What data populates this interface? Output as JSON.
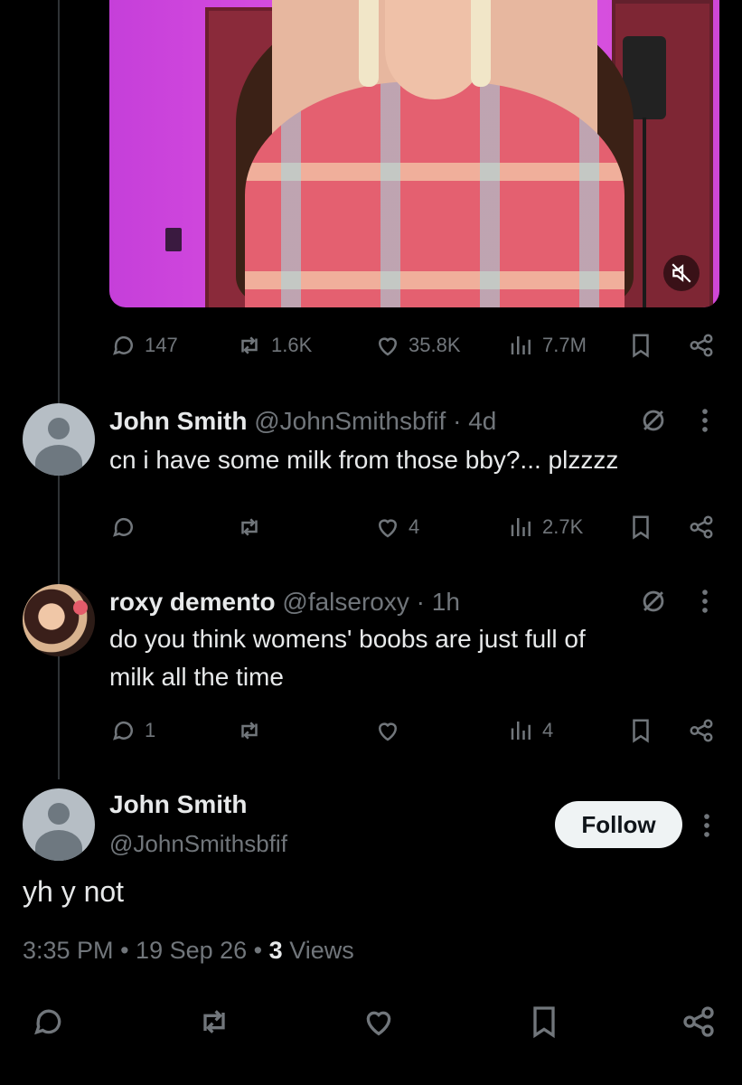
{
  "main_tweet": {
    "stats": {
      "replies": "147",
      "reposts": "1.6K",
      "likes": "35.8K",
      "views": "7.7M"
    }
  },
  "replies": [
    {
      "name": "John Smith",
      "handle": "@JohnSmithsbfif",
      "time": "· 4d",
      "text": "cn i have some milk from those bby?... plzzzz",
      "stats": {
        "replies": "",
        "reposts": "",
        "likes": "4",
        "views": "2.7K"
      }
    },
    {
      "name": "roxy demento",
      "handle": "@falseroxy",
      "time": "· 1h",
      "text_line1": "do you think womens' boobs are just full of",
      "text_line2": "milk all the time",
      "stats": {
        "replies": "1",
        "reposts": "",
        "likes": "",
        "views": "4"
      }
    }
  ],
  "focused_tweet": {
    "name": "John Smith",
    "handle": "@JohnSmithsbfif",
    "follow_label": "Follow",
    "text": "yh y not",
    "time": "3:35 PM",
    "sep": "•",
    "date": "19 Sep 26",
    "views_count": "3",
    "views_label": "Views"
  },
  "colors": {
    "background": "#000000",
    "text": "#e7e9ea",
    "muted": "#71767b",
    "button_bg": "#eff3f4"
  },
  "icons": [
    "reply-icon",
    "repost-icon",
    "like-icon",
    "views-icon",
    "bookmark-icon",
    "share-icon",
    "grok-icon",
    "more-icon",
    "mute-icon"
  ]
}
